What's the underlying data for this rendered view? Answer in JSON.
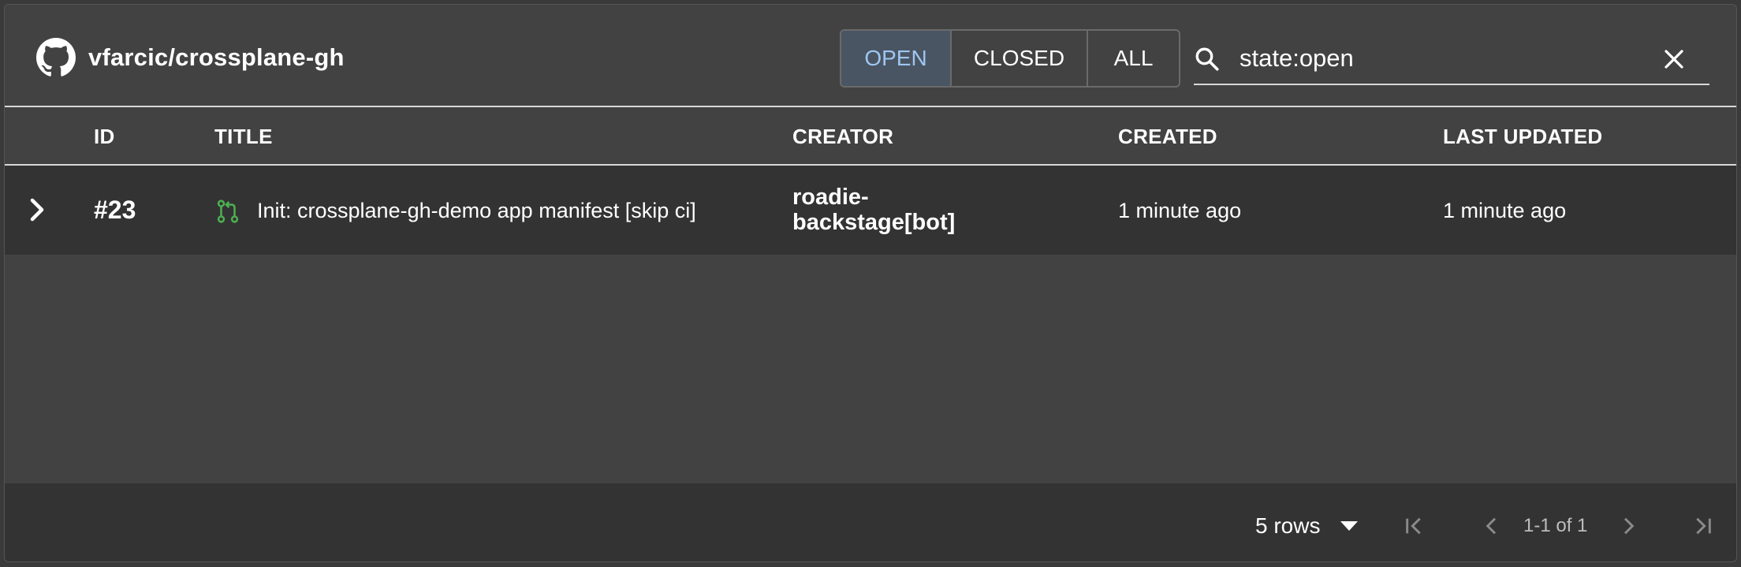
{
  "repo": {
    "title": "vfarcic/crossplane-gh",
    "icon": "github-icon"
  },
  "state_filter": {
    "options": [
      "OPEN",
      "CLOSED",
      "ALL"
    ],
    "selected": "OPEN"
  },
  "search": {
    "value": "state:open",
    "icon": "search-icon",
    "clear_icon": "close-icon"
  },
  "columns": [
    "ID",
    "TITLE",
    "CREATOR",
    "CREATED",
    "LAST UPDATED"
  ],
  "rows": [
    {
      "id": "#23",
      "type_icon": "pull-request-icon",
      "title": "Init: crossplane-gh-demo app manifest [skip ci]",
      "creator_line1": "roadie-",
      "creator_line2": "backstage[bot]",
      "created": "1 minute ago",
      "last_updated": "1 minute ago"
    }
  ],
  "pagination": {
    "rows_per_page": "5 rows",
    "range": "1-1 of 1"
  },
  "colors": {
    "background": "#424242",
    "row_background": "#333333",
    "selected_tab_text": "#9ec6f0",
    "pull_request_icon": "#4caf50"
  }
}
